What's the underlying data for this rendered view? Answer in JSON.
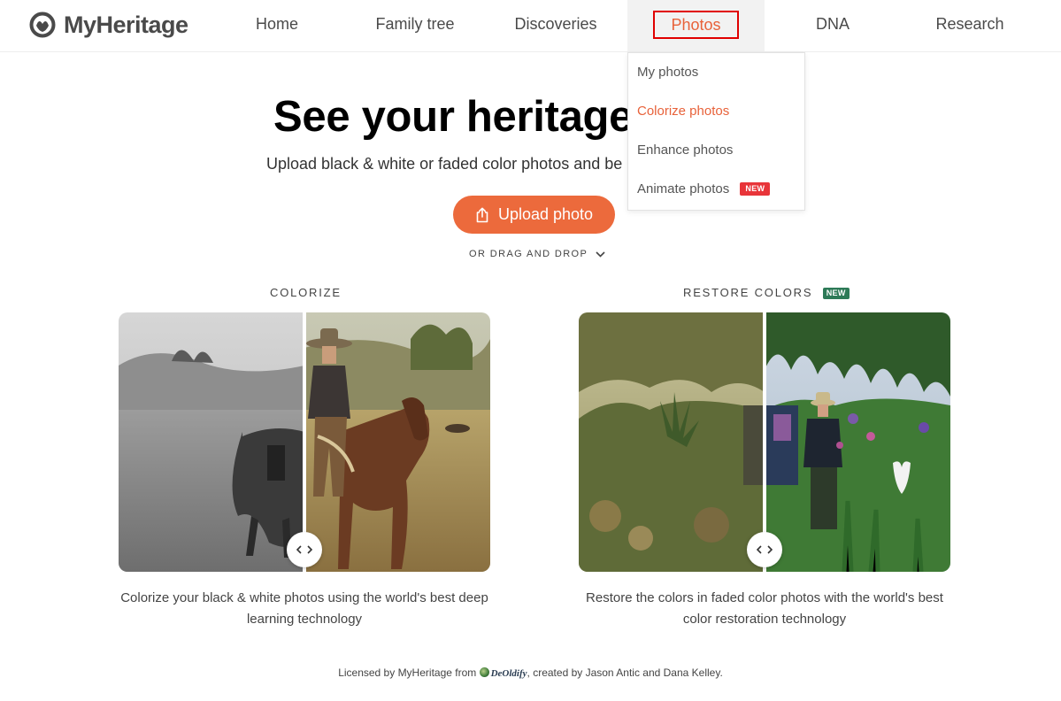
{
  "brand": {
    "name": "MyHeritage"
  },
  "nav": {
    "items": [
      {
        "label": "Home"
      },
      {
        "label": "Family tree"
      },
      {
        "label": "Discoveries"
      },
      {
        "label": "Photos",
        "active": true
      },
      {
        "label": "DNA"
      },
      {
        "label": "Research"
      }
    ]
  },
  "dropdown": {
    "items": [
      {
        "label": "My photos"
      },
      {
        "label": "Colorize photos",
        "selected": true
      },
      {
        "label": "Enhance photos"
      },
      {
        "label": "Animate photos",
        "badge": "NEW"
      }
    ]
  },
  "hero": {
    "title": "See your heritage",
    "subtitle": "Upload black & white or faded color photos and be",
    "upload_label": "Upload photo",
    "drag_drop_label": "OR DRAG AND DROP"
  },
  "cards": [
    {
      "title": "COLORIZE",
      "description": "Colorize your black & white photos using the world's best deep learning technology"
    },
    {
      "title": "RESTORE COLORS",
      "badge": "NEW",
      "description": "Restore the colors in faded color photos with the world's best color restoration technology"
    }
  ],
  "footer": {
    "prefix": "Licensed by MyHeritage from",
    "partner": "DeOldify",
    "suffix": ", created by Jason Antic and Dana Kelley."
  },
  "colors": {
    "accent": "#ec6a3c",
    "selected_text": "#e8623a",
    "highlight_box": "#e00000",
    "badge_red": "#e8353a",
    "badge_green": "#2d7a57"
  },
  "icons": {
    "logo": "myheritage-logo-icon",
    "upload": "upload-icon",
    "chevron": "chevron-down-icon",
    "slider": "compare-slider-icon"
  }
}
